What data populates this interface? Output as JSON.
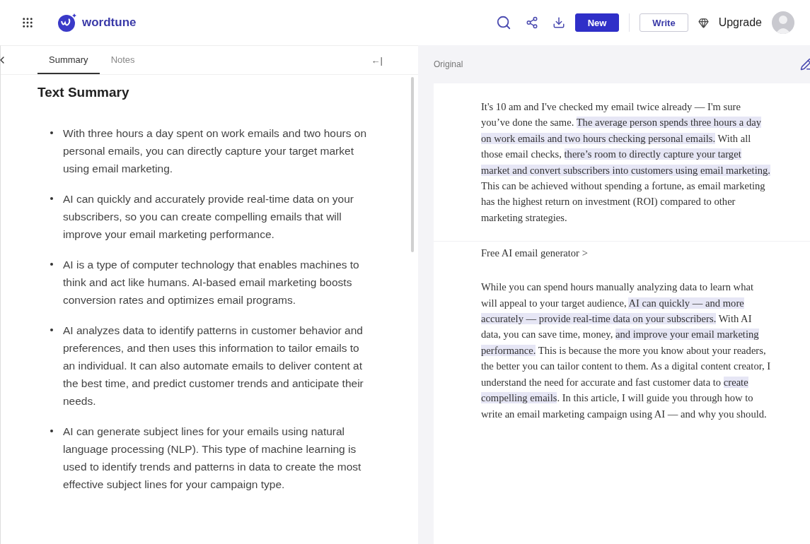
{
  "header": {
    "logo": "wordtune",
    "buttons": [
      {
        "label": "New",
        "kind": "primary"
      },
      {
        "label": "Write",
        "kind": "outline"
      }
    ],
    "upgrade": "Upgrade"
  },
  "sidebar": {
    "tabs": [
      {
        "label": "Summary",
        "selected": true
      },
      {
        "label": "Notes",
        "selected": false
      }
    ],
    "collapse": "←|",
    "title": "Text Summary",
    "bullets": [
      "With three hours a day spent on work emails and two hours on personal emails, you can directly capture your target market using email marketing.",
      "AI can quickly and accurately provide real-time data on your subscribers, so you can create compelling emails that will improve your email marketing performance.",
      "AI is a type of computer technology that enables machines to think and act like humans. AI-based email marketing boosts conversion rates and optimizes email programs.",
      "AI analyzes data to identify patterns in customer behavior and preferences, and then uses this information to tailor emails to an individual. It can also automate emails to deliver content at the best time, and predict customer trends and anticipate their needs.",
      "AI can generate subject lines for your emails using natural language processing (NLP). This type of machine learning is used to identify trends and patterns in data to create the most effective subject lines for your campaign type."
    ]
  },
  "document": {
    "label": "Original",
    "paragraphs": [
      {
        "kind": "text",
        "segments": [
          {
            "text": "It's 10 am and I've checked my email twice already — I'm sure you’ve done the same. ",
            "highlighted": false
          },
          {
            "text": "The average person spends three hours a day on work emails and two hours checking personal emails.",
            "highlighted": true
          },
          {
            "text": " With all those email checks, ",
            "highlighted": false
          },
          {
            "text": "there’s room to directly capture your target market and convert subscribers into customers using email marketing.",
            "highlighted": true
          },
          {
            "text": " This can be achieved without spending a fortune, as email marketing has the highest return on investment (ROI) compared to other marketing strategies.",
            "highlighted": false
          }
        ]
      },
      {
        "kind": "link",
        "text": "Free AI email generator >"
      },
      {
        "kind": "text",
        "segments": [
          {
            "text": "While you can spend hours manually analyzing data to learn what will appeal to your target audience, ",
            "highlighted": false
          },
          {
            "text": "AI can quickly — and more accurately — provide real-time data on your subscribers.",
            "highlighted": true
          },
          {
            "text": " With AI data, you can save time, money, ",
            "highlighted": false
          },
          {
            "text": "and improve your email marketing performance.",
            "highlighted": true
          },
          {
            "text": " This is because the more you know about your readers, the better you can tailor content to them. As a digital content creator, I understand the need for accurate and fast customer data to ",
            "highlighted": false
          },
          {
            "text": "create compelling emails",
            "highlighted": true
          },
          {
            "text": ". In this article, I will guide you through how to write an email marketing campaign using AI — and why you should.",
            "highlighted": false
          }
        ]
      }
    ]
  }
}
